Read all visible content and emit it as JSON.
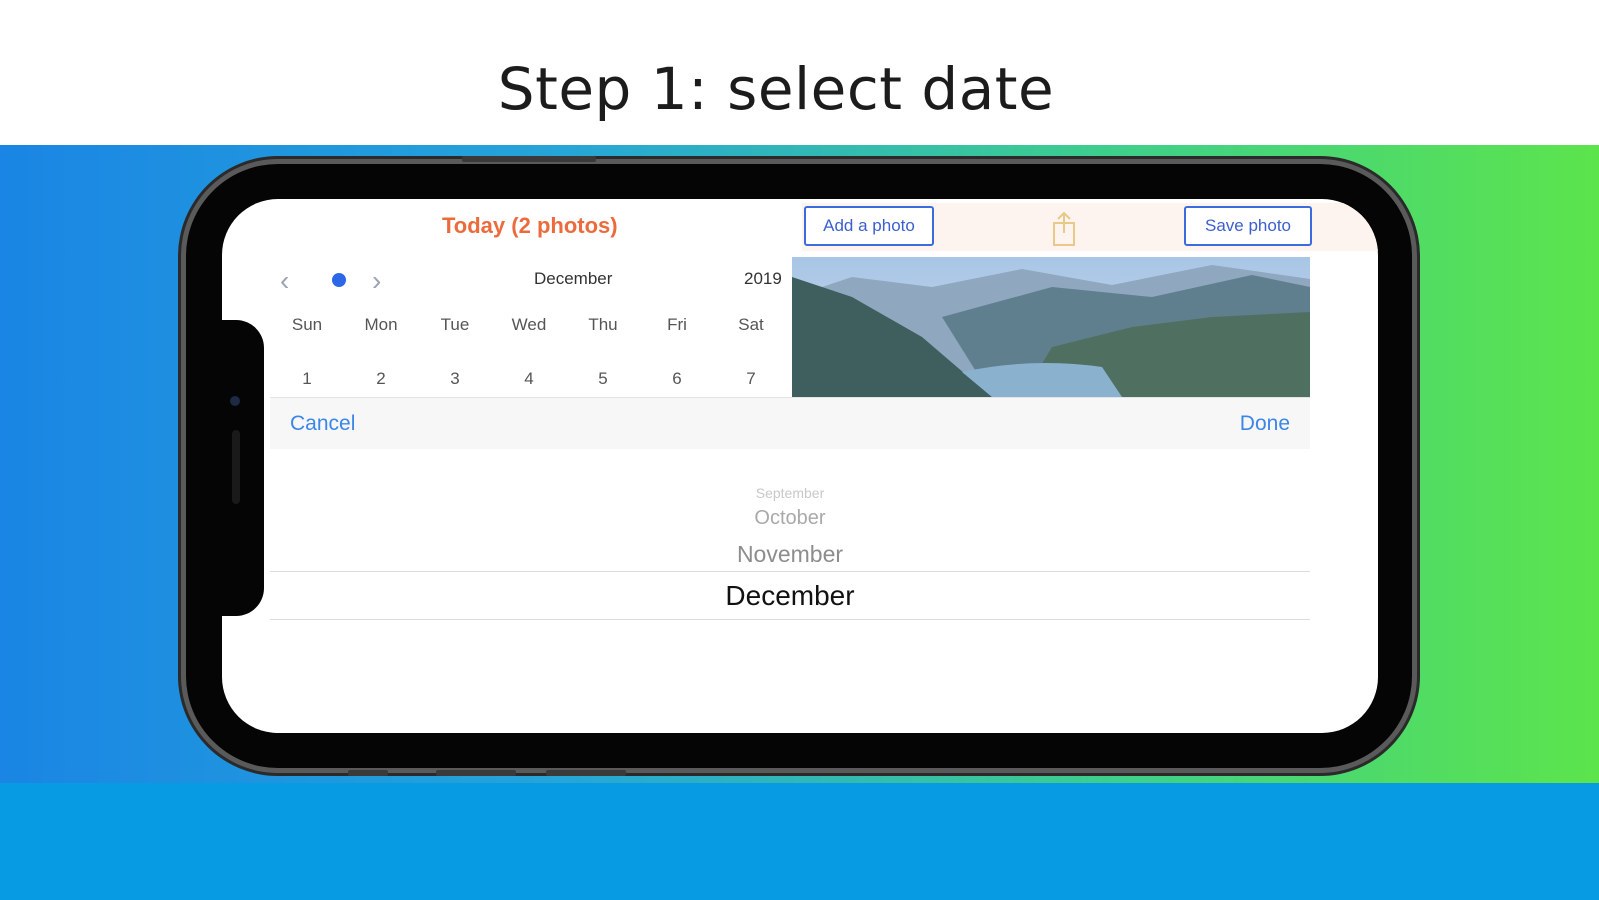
{
  "headline": "Step 1: select date",
  "app": {
    "today_label": "Today (2 photos)",
    "add_photo_label": "Add a photo",
    "save_photo_label": "Save photo"
  },
  "calendar": {
    "month": "December",
    "year": "2019",
    "weekdays": [
      "Sun",
      "Mon",
      "Tue",
      "Wed",
      "Thu",
      "Fri",
      "Sat"
    ],
    "days": [
      "1",
      "2",
      "3",
      "4",
      "5",
      "6",
      "7"
    ]
  },
  "toolbar": {
    "cancel_label": "Cancel",
    "done_label": "Done"
  },
  "picker": {
    "options": [
      "September",
      "October",
      "November",
      "December"
    ],
    "selected": "December"
  },
  "colors": {
    "accent_orange": "#ec6b3d",
    "link_blue": "#3c86e8",
    "button_blue": "#3b5fcf",
    "footer_blue": "#069be3"
  },
  "icons": {
    "prev": "chevron-left-icon",
    "next": "chevron-right-icon",
    "share": "share-icon"
  }
}
